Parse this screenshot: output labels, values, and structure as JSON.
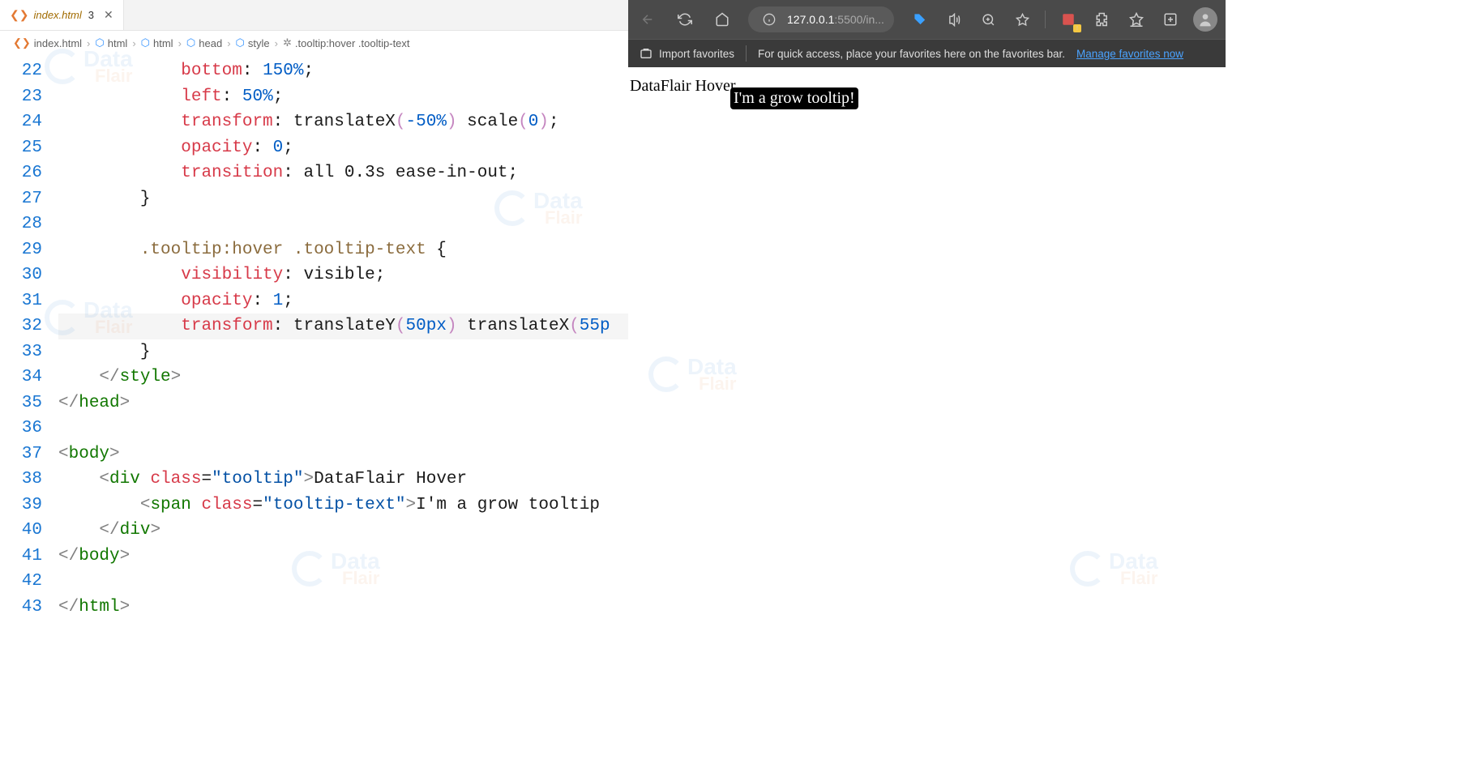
{
  "editor": {
    "tab": {
      "label": "index.html",
      "modified": "3"
    },
    "breadcrumbs": [
      "index.html",
      "html",
      "html",
      "head",
      "style",
      ".tooltip:hover .tooltip-text"
    ],
    "line_numbers": [
      "22",
      "23",
      "24",
      "25",
      "26",
      "27",
      "28",
      "29",
      "30",
      "31",
      "32",
      "33",
      "34",
      "35",
      "36",
      "37",
      "38",
      "39",
      "40",
      "41",
      "42",
      "43"
    ],
    "code": {
      "l22_prop": "bottom",
      "l22_val": "150%",
      "l23_prop": "left",
      "l23_val": "50%",
      "l24_prop": "transform",
      "l24_fn1": "translateX",
      "l24_arg1": "-50%",
      "l24_fn2": "scale",
      "l24_arg2": "0",
      "l25_prop": "opacity",
      "l25_val": "0",
      "l26_prop": "transition",
      "l26_val": "all 0.3s ease-in-out",
      "l29_sel": ".tooltip:hover .tooltip-text",
      "l30_prop": "visibility",
      "l30_val": "visible",
      "l31_prop": "opacity",
      "l31_val": "1",
      "l32_prop": "transform",
      "l32_fn1": "translateY",
      "l32_arg1": "50px",
      "l32_fn2": "translateX",
      "l32_arg2": "55p",
      "l34_tag": "style",
      "l35_tag": "head",
      "l37_tag": "body",
      "l38_tag": "div",
      "l38_attr": "class",
      "l38_val": "\"tooltip\"",
      "l38_text": "DataFlair Hover",
      "l39_tag": "span",
      "l39_attr": "class",
      "l39_val": "\"tooltip-text\"",
      "l39_text": "I'm a grow tooltip",
      "l40_tag": "div",
      "l41_tag": "body",
      "l43_tag": "html"
    }
  },
  "browser": {
    "url_host": "127.0.0.1",
    "url_port": ":5500",
    "url_path": "/in...",
    "favorites": {
      "import": "Import favorites",
      "hint": "For quick access, place your favorites here on the favorites bar.",
      "manage": "Manage favorites now"
    },
    "page": {
      "hover_text": "DataFlair Hover",
      "tooltip_text": "I'm a grow tooltip!"
    }
  },
  "watermark": {
    "l1": "Data",
    "l2": "Flair"
  }
}
